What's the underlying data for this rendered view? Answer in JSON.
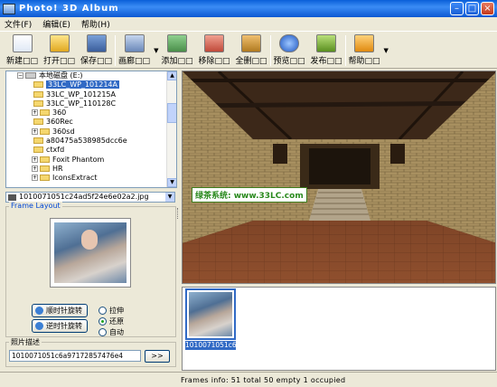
{
  "window": {
    "title": "Photo! 3D Album"
  },
  "menu": [
    "文件(F)",
    "编辑(E)",
    "帮助(H)"
  ],
  "toolbar": {
    "new": "新建□□",
    "open": "打开□□",
    "save": "保存□□",
    "album": "画廊□□",
    "add": "添加□□",
    "remove": "移除□□",
    "all": "全删□□",
    "preview": "预览□□",
    "publish": "发布□□",
    "help": "帮助□□"
  },
  "tree": {
    "root": "本地磁盘 (E:)",
    "items": [
      "33LC_WP_101214A",
      "33LC_WP_101215A",
      "33LC_WP_110128C",
      "360",
      "360Rec",
      "360sd",
      "a80475a538985dcc6e",
      "ctxfd",
      "Foxit Phantom",
      "HR",
      "IconsExtract"
    ],
    "selected": "33LC_WP_101214A"
  },
  "file_combo": "1010071051c24ad5f24e6e02a2.jpg",
  "frame_layout": {
    "title": "Frame Layout",
    "rotate_cw": "顺时针旋转",
    "rotate_ccw": "逆时针旋转",
    "options": [
      "拉伸",
      "还原",
      "自动"
    ],
    "selected": "还原"
  },
  "description": {
    "label": "照片描述",
    "value": "1010071051c6a97172857476e4",
    "button": ">>"
  },
  "watermark": "绿茶系统: www.33LC.com",
  "thumbnail": {
    "label": "1010071051c6..."
  },
  "status": {
    "text": "Frames info:   51 total   50 empty   1 occupied"
  }
}
